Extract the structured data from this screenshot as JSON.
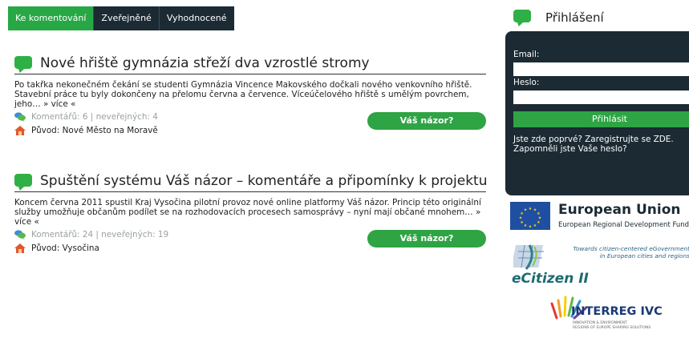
{
  "tabs": [
    {
      "label": "Ke komentování",
      "active": true
    },
    {
      "label": "Zveřejněné",
      "active": false
    },
    {
      "label": "Vyhodnocené",
      "active": false
    }
  ],
  "articles": [
    {
      "title": "Nové hřiště gymnázia střeží dva vzrostlé stromy",
      "text": "Po takřka nekonečném čekání se studenti Gymnázia Vincence Makovského dočkali nového venkovního hřiště. Stavební práce tu byly dokončeny na přelomu června a července. Víceúčelového hřiště s umělým povrchem, jeho…",
      "more": "» více «",
      "comments": "Komentářů: 6 | neveřejných: 4",
      "origin": "Původ: Nové Město na Moravě",
      "button": "Váš názor?"
    },
    {
      "title": "Spuštění systému Váš názor – komentáře a připomínky k projektu",
      "text": "Koncem června 2011 spustil Kraj Vysočina pilotní provoz nové online platformy Váš názor. Princip této originální služby umožňuje občanům podílet se na rozhodovacích procesech samosprávy – nyní mají občané mnohem…",
      "more": "» více «",
      "comments": "Komentářů: 24 | neveřejných: 19",
      "origin": "Původ: Vysočina",
      "button": "Váš názor?"
    }
  ],
  "login": {
    "title": "Přihlášení",
    "email_label": "Email:",
    "email_value": "",
    "password_label": "Heslo:",
    "password_value": "",
    "submit": "Přihlásit",
    "register_link": "Jste zde poprvé? Zaregistrujte se ZDE.",
    "forgot_link": "Zapomněli jste Vaše heslo?"
  },
  "logos": {
    "eu_title": "European Union",
    "eu_subtitle": "European Regional Development Fund",
    "ecitizen_tagline": "Towards citizen-centered eGovernment in European cities and regions",
    "ecitizen_name": "eCitizen II",
    "interreg_name": "INTERREG IVC",
    "interreg_sub1": "INNOVATION & ENVIRONMENT",
    "interreg_sub2": "REGIONS OF EUROPE SHARING SOLUTIONS"
  },
  "colors": {
    "green": "#2ea444",
    "dark": "#1b2a33",
    "meta_gray": "#9aa0a4"
  },
  "icons": {
    "article": "speech-bubble-icon",
    "comments": "comments-icon",
    "origin": "home-icon"
  }
}
